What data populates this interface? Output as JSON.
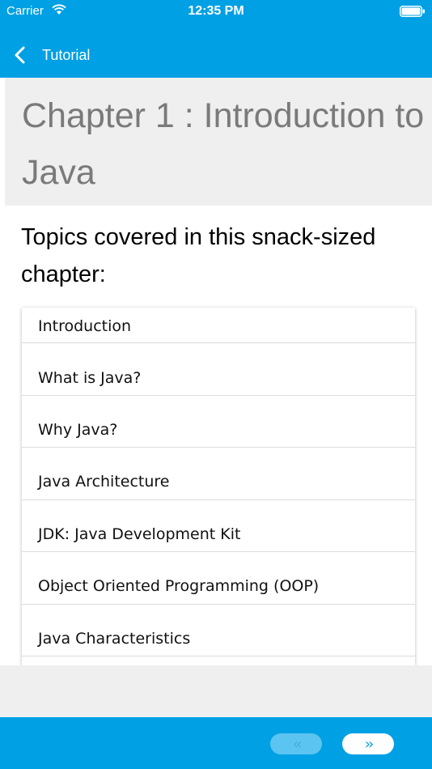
{
  "status_bar": {
    "carrier": "Carrier",
    "time": "12:35 PM"
  },
  "nav": {
    "back_label": "Tutorial"
  },
  "chapter": {
    "title": "Chapter 1 : Introduction to Java"
  },
  "topics": {
    "heading": "Topics covered in this snack-sized chapter:",
    "items": [
      "Introduction",
      "What is Java?",
      "Why Java?",
      "Java Architecture",
      "JDK: Java Development Kit",
      "Object Oriented Programming (OOP)",
      "Java Characteristics"
    ]
  },
  "pager": {
    "prev_label": "‹‹",
    "next_label": "››"
  },
  "colors": {
    "accent": "#00a0e4",
    "header_bg": "#efefef",
    "title_text": "#7a7a7a"
  }
}
